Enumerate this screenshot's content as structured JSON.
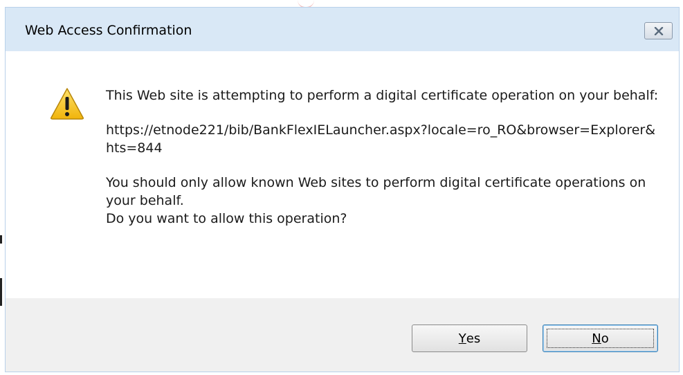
{
  "dialog": {
    "title": "Web Access Confirmation",
    "close_icon": "close-x-icon"
  },
  "message": {
    "icon": "warning-icon",
    "line1": "This Web site is attempting to perform a digital certificate operation on your behalf:",
    "url": "https://etnode221/bib/BankFlexIELauncher.aspx?locale=ro_RO&browser=Explorer&hts=844",
    "line3": "You should only allow known Web sites to perform digital certificate operations on your behalf.",
    "line4": "Do you want to allow this operation?"
  },
  "buttons": {
    "yes_mnemonic": "Y",
    "yes_rest": "es",
    "no_mnemonic": "N",
    "no_rest": "o"
  },
  "colors": {
    "titlebar": "#d9e8f6",
    "footer": "#f0f0f0",
    "warning_fill": "#f5c518"
  }
}
